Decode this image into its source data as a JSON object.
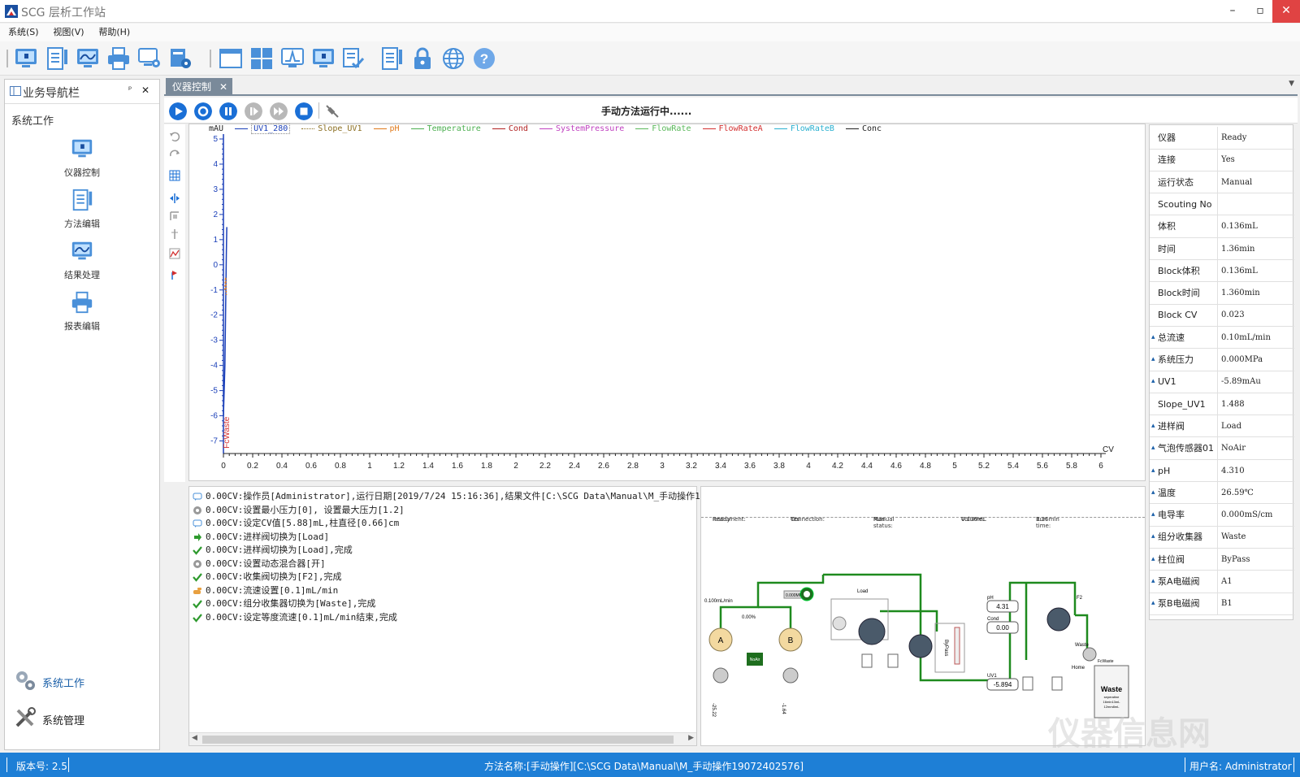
{
  "window": {
    "title": "SCG 层析工作站"
  },
  "menu": {
    "items": [
      "系统(S)",
      "视图(V)",
      "帮助(H)"
    ]
  },
  "nav": {
    "header": "业务导航栏",
    "pin": "ᵖ",
    "close": "✕",
    "section": "系统工作",
    "items": [
      {
        "label": "仪器控制"
      },
      {
        "label": "方法编辑"
      },
      {
        "label": "结果处理"
      },
      {
        "label": "报表编辑"
      }
    ],
    "bottom": [
      {
        "label": "系统工作"
      },
      {
        "label": "系统管理"
      }
    ]
  },
  "tab": {
    "label": "仪器控制",
    "close": "✕"
  },
  "control": {
    "status": "手动方法运行中......"
  },
  "chart_data": {
    "type": "line",
    "ylabel": "mAU",
    "xlabel": "CV",
    "ylim": [
      -7.5,
      5
    ],
    "xlim": [
      0,
      6
    ],
    "yticks": [
      5,
      4,
      3,
      2,
      1,
      0,
      -1,
      -2,
      -3,
      -4,
      -5,
      -6,
      -7
    ],
    "xticks": [
      "0",
      "0.2",
      "0.4",
      "0.6",
      "0.8",
      "1",
      "1.2",
      "1.4",
      "1.6",
      "1.8",
      "2",
      "2.2",
      "2.4",
      "2.6",
      "2.8",
      "3",
      "3.2",
      "3.4",
      "3.6",
      "3.8",
      "4",
      "4.2",
      "4.4",
      "4.6",
      "4.8",
      "5",
      "5.2",
      "5.4",
      "5.6",
      "5.8",
      "6"
    ],
    "series": [
      {
        "name": "UV1_280",
        "color": "#1a3fb8",
        "x": [
          0,
          0.01,
          0.02,
          0.023
        ],
        "y": [
          -6.0,
          -4.0,
          0.5,
          1.5
        ]
      },
      {
        "name": "Slope_UV1",
        "color": "#8a6d1f"
      },
      {
        "name": "pH",
        "color": "#e07a1b",
        "x": [
          0.01,
          0.015,
          0.02
        ],
        "y": [
          -1.0,
          -0.5,
          -1.2
        ]
      },
      {
        "name": "Temperature",
        "color": "#4caf50"
      },
      {
        "name": "Cond",
        "color": "#b22222"
      },
      {
        "name": "SystemPressure",
        "color": "#c042c0"
      },
      {
        "name": "FlowRate",
        "color": "#5ab85a"
      },
      {
        "name": "FlowRateA",
        "color": "#d32f2f"
      },
      {
        "name": "FlowRateB",
        "color": "#2ab0d0"
      },
      {
        "name": "Conc",
        "color": "#222222"
      }
    ],
    "annotations": [
      {
        "text": "FcWaste",
        "color": "#d32f2f",
        "x": 0.04,
        "y": -7.3
      }
    ],
    "grid": false
  },
  "log": {
    "entries": [
      {
        "icon": "info",
        "text": "0.00CV:操作员[Administrator],运行日期[2019/7/24 15:16:36],结果文件[C:\\SCG Data\\Manual\\M_手动操作19072402576]"
      },
      {
        "icon": "gear",
        "text": "0.00CV:设置最小压力[0], 设置最大压力[1.2]"
      },
      {
        "icon": "info",
        "text": "0.00CV:设定CV值[5.88]mL,柱直径[0.66]cm"
      },
      {
        "icon": "arrow",
        "text": "0.00CV:进样阀切换为[Load]"
      },
      {
        "icon": "check",
        "text": "0.00CV:进样阀切换为[Load],完成"
      },
      {
        "icon": "gear",
        "text": "0.00CV:设置动态混合器[开]"
      },
      {
        "icon": "check",
        "text": "0.00CV:收集阀切换为[F2],完成"
      },
      {
        "icon": "hand",
        "text": "0.00CV:流速设置[0.1]mL/min"
      },
      {
        "icon": "check",
        "text": "0.00CV:组分收集器切换为[Waste],完成"
      },
      {
        "icon": "check",
        "text": "0.00CV:设定等度流速[0.1]mL/min结束,完成"
      }
    ]
  },
  "flow": {
    "instrument_label": "Instrument:",
    "instrument": "Ready",
    "connection_label": "Connection:",
    "connection": "Yes",
    "run_status_label": "Run status:",
    "run_status": "Manual",
    "volume_label": "Volume:",
    "volume": "0.136mL",
    "run_time_label": "Run time:",
    "run_time": "1.36min",
    "flow_rate": "0.100mL/min",
    "pct": "0.00%",
    "pressure": "0.000MPa",
    "load": "Load",
    "pump_a": "A",
    "pump_b": "B",
    "noair": "NoAir",
    "bypass": "ByPass",
    "ph_label": "pH",
    "ph": "4.31",
    "cond_label": "Cond",
    "cond": "0.00",
    "uv_label": "UV1",
    "uv": "-5.894",
    "f2": "F2",
    "waste": "Waste",
    "home": "Home",
    "fcwaste": "FcWaste",
    "gauge_a": "-25.22",
    "gauge_b": "-1.64",
    "waste_box": "Waste",
    "waste_lines": [
      "seperatine",
      "16min13mL",
      "12mm8mL"
    ]
  },
  "props": {
    "rows": [
      {
        "k": "仪器",
        "v": "Ready",
        "exp": false
      },
      {
        "k": "连接",
        "v": "Yes",
        "exp": false
      },
      {
        "k": "运行状态",
        "v": "Manual",
        "exp": false
      },
      {
        "k": "Scouting No",
        "v": "",
        "exp": false
      },
      {
        "k": "体积",
        "v": "0.136mL",
        "exp": false
      },
      {
        "k": "时间",
        "v": "1.36min",
        "exp": false
      },
      {
        "k": "Block体积",
        "v": "0.136mL",
        "exp": false
      },
      {
        "k": "Block时间",
        "v": "1.360min",
        "exp": false
      },
      {
        "k": "Block CV",
        "v": "0.023",
        "exp": false
      },
      {
        "k": "总流速",
        "v": "0.10mL/min",
        "exp": true
      },
      {
        "k": "系统压力",
        "v": "0.000MPa",
        "exp": true
      },
      {
        "k": "UV1",
        "v": "-5.89mAu",
        "exp": true
      },
      {
        "k": "Slope_UV1",
        "v": "1.488",
        "exp": false
      },
      {
        "k": "进样阀",
        "v": "Load",
        "exp": true
      },
      {
        "k": "气泡传感器01",
        "v": "NoAir",
        "exp": true
      },
      {
        "k": "pH",
        "v": "4.310",
        "exp": true
      },
      {
        "k": "温度",
        "v": "26.59℃",
        "exp": true
      },
      {
        "k": "电导率",
        "v": "0.000mS/cm",
        "exp": true
      },
      {
        "k": "组分收集器",
        "v": "Waste",
        "exp": true
      },
      {
        "k": "柱位阀",
        "v": "ByPass",
        "exp": true
      },
      {
        "k": "泵A电磁阀",
        "v": "A1",
        "exp": true
      },
      {
        "k": "泵B电磁阀",
        "v": "B1",
        "exp": true
      }
    ]
  },
  "statusbar": {
    "version": "版本号: 2.5",
    "method": "方法名称:[手动操作][C:\\SCG Data\\Manual\\M_手动操作19072402576]",
    "user": "用户名:   Administrator"
  },
  "watermark": "仪器信息网",
  "colors": {
    "accent": "#1e7fd6",
    "tab": "#7a8a9a",
    "flowline": "#1e8a1e"
  }
}
